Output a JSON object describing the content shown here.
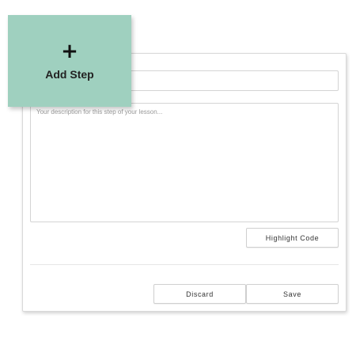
{
  "add_step": {
    "icon": "plus-icon",
    "icon_glyph": "+",
    "label": "Add Step",
    "color": "#9fd0bf"
  },
  "form": {
    "title_value": "",
    "description_placeholder": "Your description for this step of your lesson..."
  },
  "actions": {
    "highlight_code_label": "Highlight Code",
    "discard_label": "Discard",
    "save_label": "Save"
  }
}
